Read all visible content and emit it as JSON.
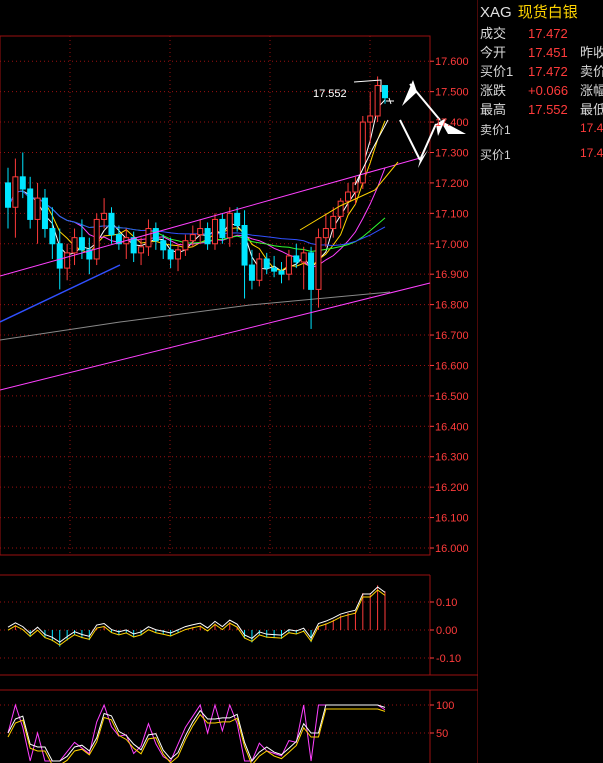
{
  "header": {
    "code": "XAG",
    "name": "现货白银"
  },
  "quote": [
    {
      "label": "成交",
      "value": "17.472",
      "label2": ""
    },
    {
      "label": "今开",
      "value": "17.451",
      "label2": "昨收"
    },
    {
      "label": "买价1",
      "value": "17.472",
      "label2": "卖价"
    },
    {
      "label": "涨跌",
      "value": "+0.066",
      "label2": "涨幅"
    },
    {
      "label": "最高",
      "value": "17.552",
      "label2": "最低"
    }
  ],
  "book": {
    "ask": {
      "label": "卖价1",
      "value": "17.4"
    },
    "bid": {
      "label": "买价1",
      "value": "17.4"
    }
  },
  "colors": {
    "up": "#ff3b3b",
    "down": "#00e5ff",
    "grid": "#9a1010",
    "axis": "#ff3b3b"
  },
  "chart_data": [
    {
      "type": "candlestick",
      "title": "",
      "ylim": [
        16.0,
        17.65
      ],
      "y_ticks": [
        "16.000",
        "16.100",
        "16.200",
        "16.300",
        "16.400",
        "16.500",
        "16.600",
        "16.700",
        "16.800",
        "16.900",
        "17.000",
        "17.100",
        "17.200",
        "17.300",
        "17.400",
        "17.500",
        "17.600"
      ],
      "annotation": "17.552",
      "ohlc": [
        [
          17.2,
          17.25,
          17.05,
          17.12
        ],
        [
          17.12,
          17.28,
          17.02,
          17.22
        ],
        [
          17.22,
          17.3,
          17.15,
          17.18
        ],
        [
          17.18,
          17.22,
          17.05,
          17.08
        ],
        [
          17.08,
          17.2,
          17.0,
          17.15
        ],
        [
          17.15,
          17.18,
          17.02,
          17.05
        ],
        [
          17.05,
          17.12,
          16.95,
          17.0
        ],
        [
          17.0,
          17.05,
          16.85,
          16.92
        ],
        [
          16.92,
          17.0,
          16.88,
          16.97
        ],
        [
          16.97,
          17.05,
          16.93,
          17.02
        ],
        [
          17.02,
          17.08,
          16.95,
          16.98
        ],
        [
          16.98,
          17.02,
          16.9,
          16.95
        ],
        [
          16.95,
          17.1,
          16.93,
          17.08
        ],
        [
          17.08,
          17.15,
          17.05,
          17.1
        ],
        [
          17.1,
          17.12,
          17.0,
          17.03
        ],
        [
          17.03,
          17.06,
          16.98,
          17.0
        ],
        [
          17.0,
          17.05,
          16.95,
          17.02
        ],
        [
          17.02,
          17.04,
          16.94,
          16.97
        ],
        [
          16.97,
          17.02,
          16.93,
          16.99
        ],
        [
          16.99,
          17.08,
          16.96,
          17.05
        ],
        [
          17.05,
          17.07,
          16.98,
          17.01
        ],
        [
          17.01,
          17.03,
          16.95,
          16.98
        ],
        [
          16.98,
          17.02,
          16.92,
          16.95
        ],
        [
          16.95,
          17.0,
          16.91,
          16.98
        ],
        [
          16.98,
          17.03,
          16.96,
          17.01
        ],
        [
          17.01,
          17.06,
          16.99,
          17.03
        ],
        [
          17.03,
          17.08,
          17.0,
          17.05
        ],
        [
          17.05,
          17.07,
          16.98,
          17.0
        ],
        [
          17.0,
          17.1,
          16.98,
          17.08
        ],
        [
          17.08,
          17.1,
          17.0,
          17.02
        ],
        [
          17.02,
          17.12,
          16.99,
          17.1
        ],
        [
          17.1,
          17.12,
          17.04,
          17.06
        ],
        [
          17.06,
          17.11,
          16.82,
          16.93
        ],
        [
          16.93,
          16.98,
          16.85,
          16.88
        ],
        [
          16.88,
          16.97,
          16.86,
          16.95
        ],
        [
          16.95,
          16.97,
          16.9,
          16.92
        ],
        [
          16.92,
          16.96,
          16.89,
          16.91
        ],
        [
          16.91,
          16.94,
          16.87,
          16.9
        ],
        [
          16.9,
          16.98,
          16.88,
          16.96
        ],
        [
          16.96,
          17.0,
          16.92,
          16.94
        ],
        [
          16.94,
          16.99,
          16.85,
          16.97
        ],
        [
          16.97,
          16.99,
          16.72,
          16.85
        ],
        [
          16.85,
          17.05,
          16.79,
          17.02
        ],
        [
          17.02,
          17.1,
          16.99,
          17.05
        ],
        [
          17.05,
          17.12,
          17.02,
          17.09
        ],
        [
          17.09,
          17.15,
          17.05,
          17.14
        ],
        [
          17.14,
          17.2,
          17.1,
          17.17
        ],
        [
          17.17,
          17.22,
          17.13,
          17.2
        ],
        [
          17.2,
          17.42,
          17.18,
          17.4
        ],
        [
          17.4,
          17.5,
          17.33,
          17.42
        ],
        [
          17.42,
          17.55,
          17.4,
          17.52
        ],
        [
          17.52,
          17.52,
          17.46,
          17.48
        ]
      ]
    },
    {
      "type": "bar",
      "title": "",
      "ylim": [
        -0.12,
        0.12
      ],
      "y_ticks": [
        "0.10",
        "0.00",
        "-0.10"
      ]
    },
    {
      "type": "line",
      "title": "",
      "ylim": [
        40,
        110
      ],
      "y_ticks": [
        "100",
        "50"
      ]
    }
  ]
}
